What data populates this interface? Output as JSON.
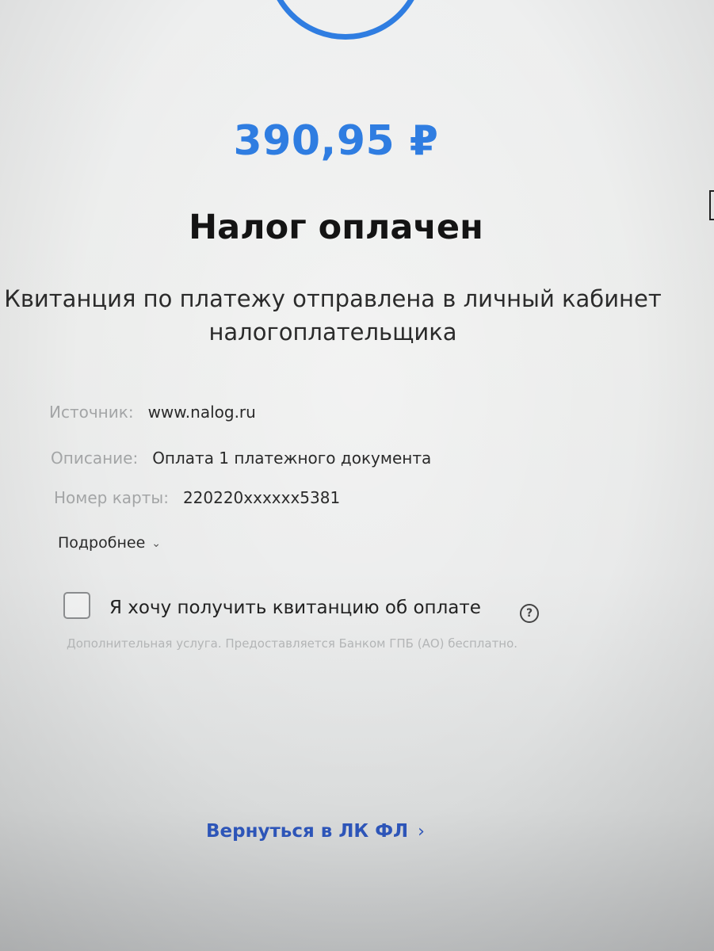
{
  "payment": {
    "amount": "390,95 ₽",
    "title": "Налог оплачен",
    "subtitle_line1": "Квитанция по платежу отправлена в личный кабинет",
    "subtitle_line2": "налогоплательщика"
  },
  "details": {
    "source_label": "Источник:",
    "source_value": "www.nalog.ru",
    "description_label": "Описание:",
    "description_value": "Оплата 1 платежного документа",
    "card_label": "Номер карты:",
    "card_value": "220220xxxxxx5381",
    "more_label": "Подробнее"
  },
  "receipt": {
    "checkbox_checked": false,
    "label": "Я хочу получить квитанцию об оплате",
    "help_symbol": "?",
    "note": "Дополнительная услуга. Предоставляется Банком ГПБ (АО) бесплатно."
  },
  "footer": {
    "back_label": "Вернуться в ЛК ФЛ"
  },
  "icons": {
    "success": "success-circle-icon",
    "expand": "chevron-down-icon",
    "help": "question-circle-icon",
    "back": "chevron-right-icon"
  },
  "colors": {
    "accent": "#2f7de1",
    "link": "#2d55b8",
    "label_gray": "#a3a5a6"
  }
}
